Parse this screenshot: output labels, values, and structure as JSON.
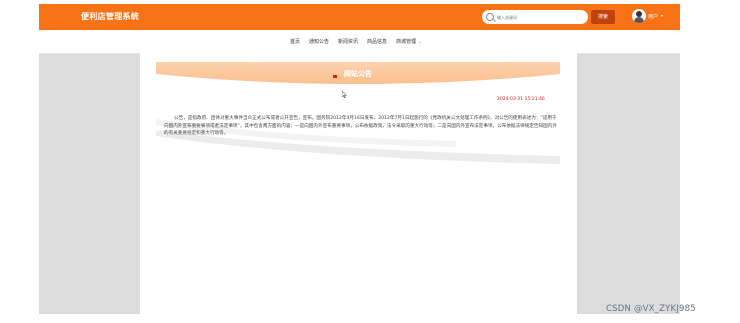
{
  "app": {
    "title": "便利店管理系统"
  },
  "search": {
    "placeholder": "输入关键词",
    "button_label": "搜索"
  },
  "user": {
    "label": "用户"
  },
  "nav": {
    "items": [
      "首页",
      "通知公告",
      "新闻资讯",
      "商品信息",
      "商城管理"
    ]
  },
  "notice": {
    "title": "网站公告",
    "date": "2024-03-31 15:21:46",
    "body": "公告，是指政府、团体对重大事件当众正式公布或者公开宣告，宣布。国务院2012年4月16日发布、2012年7月1日起施行的《党政机关公文处理工作条例》，对公告的使用表述为：“适用于向国内外宣布重要事项或者法定事项”，其中包含两方面的内容：一是向国内外宣布重要事项，公布依据政策，法令采取的重大行动等；二是向国内外宣布法定事项，公布依据法律规定告知国内外的有关重要规定和重大行动等。"
  },
  "watermark": "CSDN @VX_ZYKJ985",
  "colors": {
    "primary": "#f97316",
    "accent_dark": "#c2410c",
    "date": "#e11d1d",
    "background": "#dcdcdc"
  },
  "icons": [
    "search-icon",
    "avatar",
    "chevron-down-icon",
    "flag-icon",
    "cursor-icon"
  ]
}
